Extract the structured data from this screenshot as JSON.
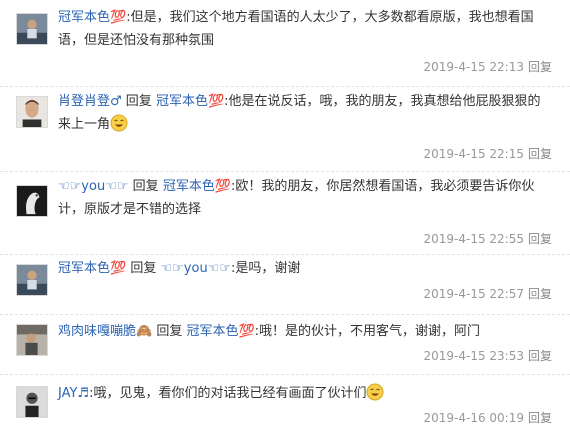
{
  "reply_word": "回复",
  "comments": [
    {
      "user": "冠军本色💯",
      "reply_to": "",
      "text": ":但是，我们这个地方看国语的人太少了，大多数都看原版，我也想看国语，但是还怕没有那种氛围",
      "time": "2019-4-15 22:13",
      "action": "回复",
      "emoji": ""
    },
    {
      "user": "肖登肖登♂",
      "reply_to": "冠军本色💯",
      "text": ":他是在说反话，哦，我的朋友，我真想给他屁股狠狠的来上一角",
      "time": "2019-4-15 22:15",
      "action": "回复",
      "emoji": "laugh-emoji"
    },
    {
      "user": "☜☞you☜☞",
      "reply_to": "冠军本色💯",
      "text": ":欧！我的朋友，你居然想看国语，我必须要告诉你伙计，原版才是不错的选择",
      "time": "2019-4-15 22:55",
      "action": "回复",
      "emoji": ""
    },
    {
      "user": "冠军本色💯",
      "reply_to": "☜☞you☜☞",
      "text": ":是吗，谢谢",
      "time": "2019-4-15 22:57",
      "action": "回复",
      "emoji": ""
    },
    {
      "user": "鸡肉味嘎嘣脆🙈",
      "reply_to": "冠军本色💯",
      "text": ":哦！是的伙计，不用客气，谢谢，阿门",
      "time": "2019-4-15 23:53",
      "action": "回复",
      "emoji": ""
    },
    {
      "user": "JAY♬",
      "reply_to": "",
      "text": ":哦，见鬼，看你们的对话我已经有画面了伙计们",
      "time": "2019-4-16 00:19",
      "action": "回复",
      "emoji": "laugh-emoji"
    }
  ]
}
